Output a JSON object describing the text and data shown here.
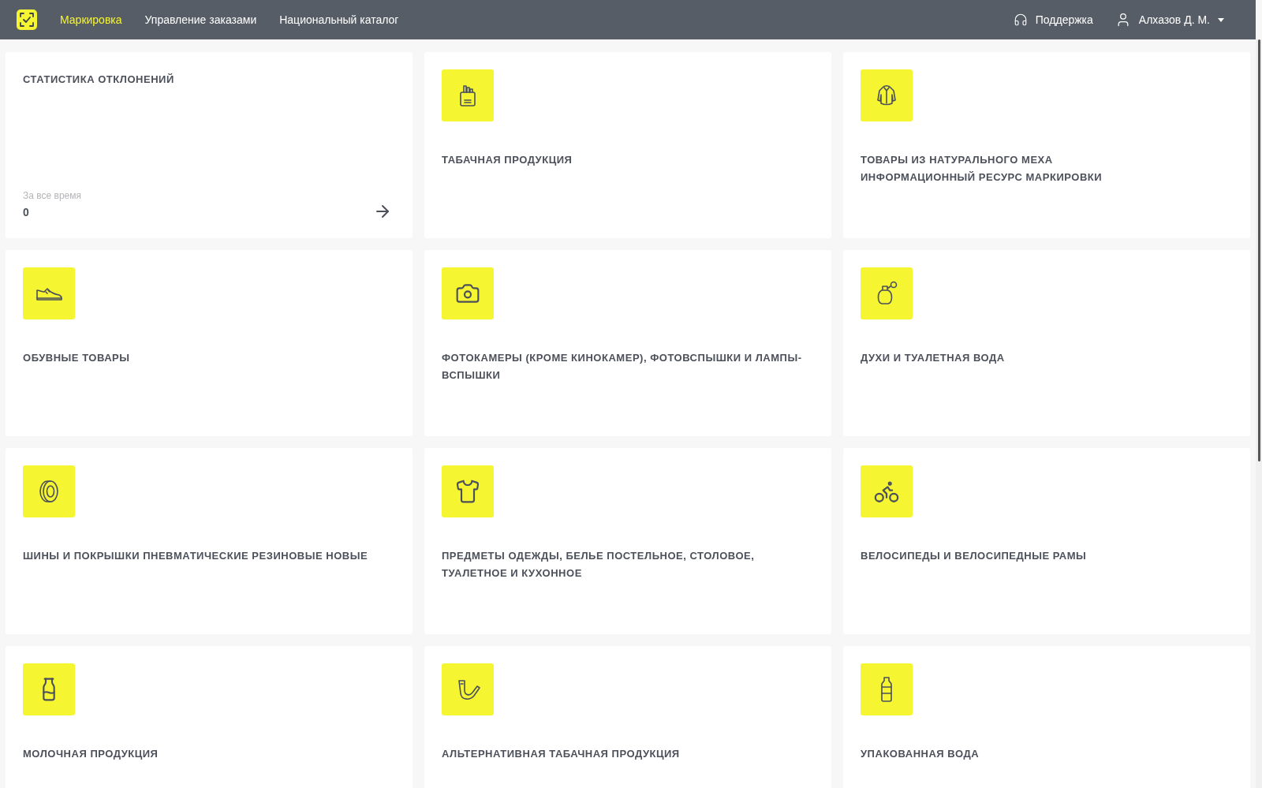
{
  "header": {
    "nav": [
      {
        "label": "Маркировка",
        "selected": true
      },
      {
        "label": "Управление заказами",
        "selected": false
      },
      {
        "label": "Национальный каталог",
        "selected": false
      }
    ],
    "support": "Поддержка",
    "user": "Алхазов Д. М."
  },
  "stats": {
    "title": "СТАТИСТИКА ОТКЛОНЕНИЙ",
    "period": "За все время",
    "value": "0"
  },
  "categories": [
    {
      "title": "ТАБАЧНАЯ ПРОДУКЦИЯ"
    },
    {
      "title": "ТОВАРЫ ИЗ НАТУРАЛЬНОГО МЕХА",
      "subtitle": "ИНФОРМАЦИОННЫЙ РЕСУРС МАРКИРОВКИ"
    },
    {
      "title": "ОБУВНЫЕ ТОВАРЫ"
    },
    {
      "title": "ФОТОКАМЕРЫ (КРОМЕ КИНОКАМЕР), ФОТОВСПЫШКИ И ЛАМПЫ-ВСПЫШКИ"
    },
    {
      "title": "ДУХИ И ТУАЛЕТНАЯ ВОДА"
    },
    {
      "title": "ШИНЫ И ПОКРЫШКИ ПНЕВМАТИЧЕСКИЕ РЕЗИНОВЫЕ НОВЫЕ"
    },
    {
      "title": "ПРЕДМЕТЫ ОДЕЖДЫ, БЕЛЬЕ ПОСТЕЛЬНОЕ, СТОЛОВОЕ, ТУАЛЕТНОЕ И КУХОННОЕ"
    },
    {
      "title": "ВЕЛОСИПЕДЫ И ВЕЛОСИПЕДНЫЕ РАМЫ"
    },
    {
      "title": "МОЛОЧНАЯ ПРОДУКЦИЯ"
    },
    {
      "title": "АЛЬТЕРНАТИВНАЯ ТАБАЧНАЯ ПРОДУКЦИЯ"
    },
    {
      "title": "УПАКОВАННАЯ ВОДА"
    }
  ]
}
